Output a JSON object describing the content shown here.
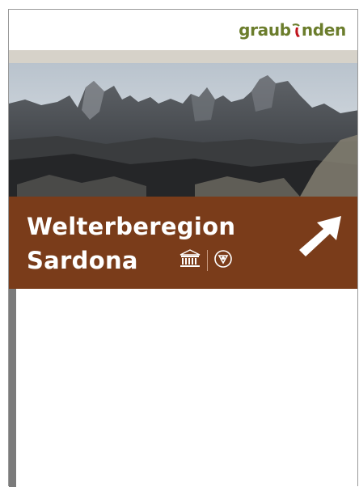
{
  "brand": {
    "logo_left": "graub",
    "logo_right": "nden"
  },
  "sign": {
    "title_line1": "Welterberegion",
    "title_line2": "Sardona",
    "colors": {
      "panel": "#7a3c1a",
      "band": "#d6d2c9",
      "post": "#7b7b7b",
      "logo": "#6b7d2c",
      "logo_mark": "#c0151d"
    }
  },
  "icons": [
    "unesco-emblem-icon",
    "world-heritage-emblem-icon",
    "arrow-up-right-icon"
  ]
}
